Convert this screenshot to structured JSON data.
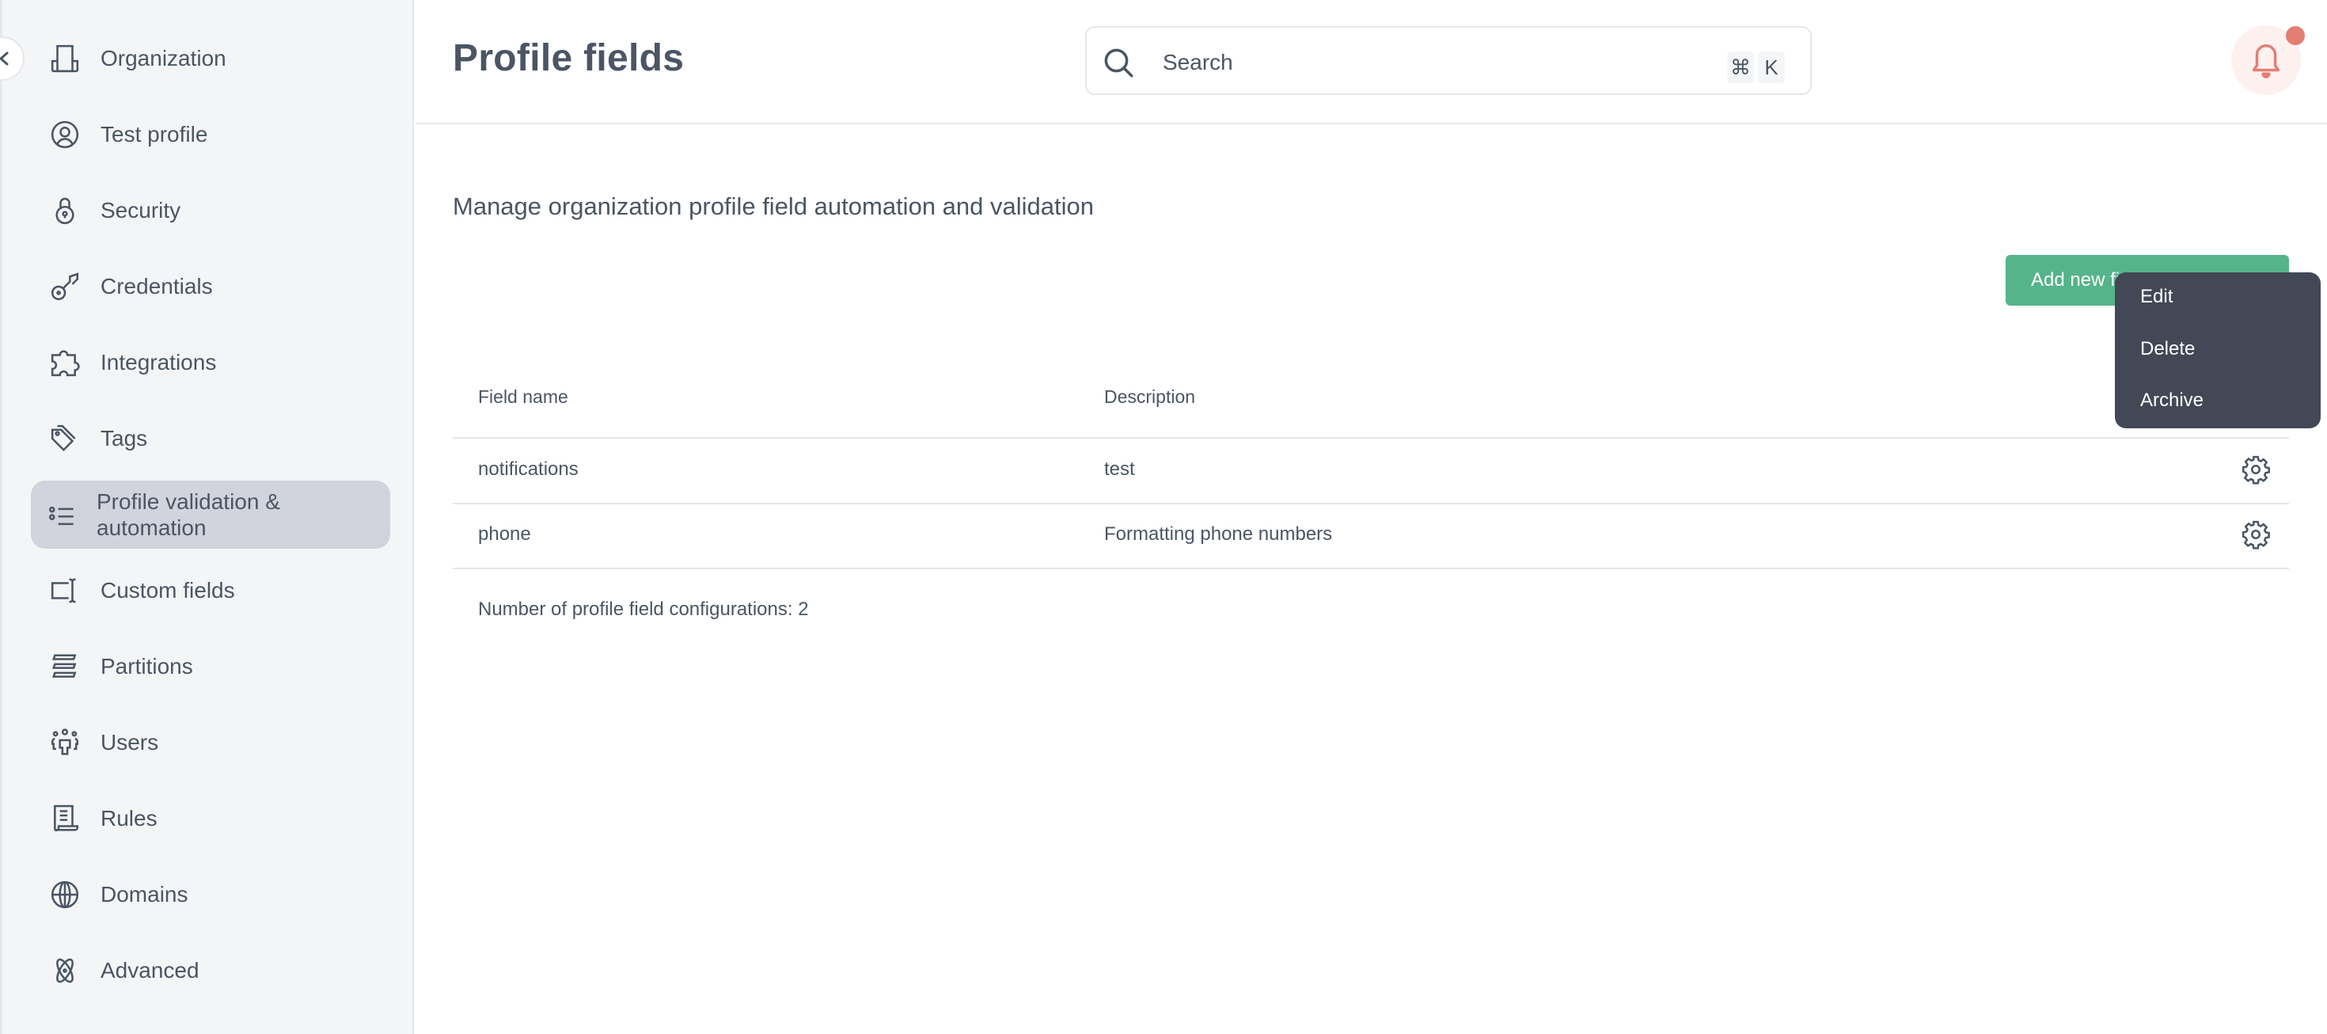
{
  "sidebar": {
    "collapse_icon": "chevron-left-icon",
    "items": [
      {
        "label": "Organization",
        "icon": "building-icon"
      },
      {
        "label": "Test profile",
        "icon": "user-circle-icon"
      },
      {
        "label": "Security",
        "icon": "lock-icon"
      },
      {
        "label": "Credentials",
        "icon": "key-icon"
      },
      {
        "label": "Integrations",
        "icon": "puzzle-icon"
      },
      {
        "label": "Tags",
        "icon": "tags-icon"
      },
      {
        "label": "Profile validation & automation",
        "icon": "list-icon",
        "active": true
      },
      {
        "label": "Custom fields",
        "icon": "text-cursor-icon"
      },
      {
        "label": "Partitions",
        "icon": "layers-icon"
      },
      {
        "label": "Users",
        "icon": "users-icon"
      },
      {
        "label": "Rules",
        "icon": "scroll-icon"
      },
      {
        "label": "Domains",
        "icon": "globe-icon"
      },
      {
        "label": "Advanced",
        "icon": "atom-icon"
      }
    ]
  },
  "header": {
    "title": "Profile fields",
    "search": {
      "placeholder": "Search",
      "shortcut_cmd": "⌘",
      "shortcut_key": "K"
    },
    "notification_icon": "bell-icon",
    "accent_color": "#e47d74"
  },
  "main": {
    "subtitle": "Manage organization profile field automation and validation",
    "add_button_label": "Add new fi",
    "table": {
      "columns": [
        "Field name",
        "Description"
      ],
      "rows": [
        {
          "field_name": "notifications",
          "description": "test"
        },
        {
          "field_name": "phone",
          "description": "Formatting phone numbers"
        }
      ],
      "footer": "Number of profile field configurations: 2"
    },
    "context_menu": {
      "items": [
        "Edit",
        "Delete",
        "Archive"
      ]
    },
    "brand_color": "#56b48a"
  }
}
